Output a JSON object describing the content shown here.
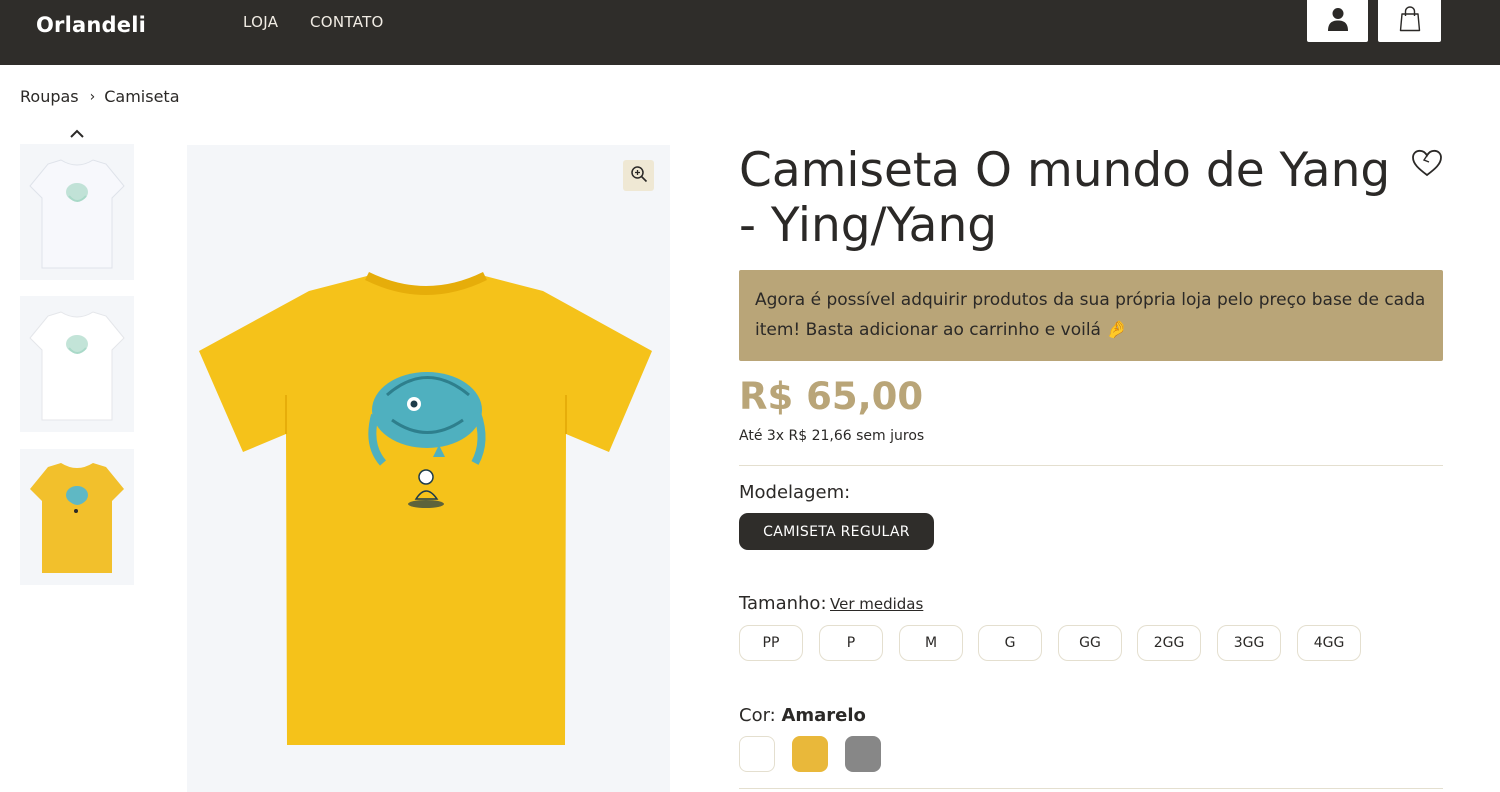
{
  "header": {
    "logo": "Orlandeli",
    "nav": [
      {
        "label": "LOJA"
      },
      {
        "label": "CONTATO"
      }
    ],
    "icons": [
      "user-icon",
      "shopping-bag-icon"
    ]
  },
  "breadcrumb": {
    "items": [
      {
        "label": "Roupas"
      },
      {
        "label": "Camiseta"
      }
    ],
    "separator": "›"
  },
  "gallery": {
    "thumbnails": [
      {
        "name": "camiseta-branca-1",
        "color": "#ffffff"
      },
      {
        "name": "camiseta-branca-2",
        "color": "#ffffff"
      },
      {
        "name": "camiseta-amarela",
        "color": "#f2c02c"
      }
    ],
    "main_shirt_color": "#f5c21a",
    "icons": [
      "chevron-up-icon",
      "zoom-in-icon"
    ]
  },
  "product": {
    "title": "Camiseta O mundo de Yang - Ying/Yang",
    "notice": "Agora é possível adquirir produtos da sua própria loja pelo preço base de cada item! Basta adicionar ao carrinho e voilá 🤌",
    "price": "R$ 65,00",
    "installments": "Até 3x R$ 21,66 sem juros",
    "model": {
      "label": "Modelagem:",
      "selected": "CAMISETA REGULAR"
    },
    "size": {
      "label": "Tamanho:",
      "link": "Ver medidas",
      "options": [
        "PP",
        "P",
        "M",
        "G",
        "GG",
        "2GG",
        "3GG",
        "4GG"
      ]
    },
    "color": {
      "label": "Cor:",
      "selected": "Amarelo",
      "swatches": [
        {
          "name": "Branco",
          "hex": "#ffffff"
        },
        {
          "name": "Amarelo",
          "hex": "#e9b83a"
        },
        {
          "name": "Cinza",
          "hex": "#878787"
        }
      ]
    }
  },
  "colors": {
    "topbar": "#2f2d2a",
    "accent": "#b9a578",
    "text": "#2b2927"
  }
}
